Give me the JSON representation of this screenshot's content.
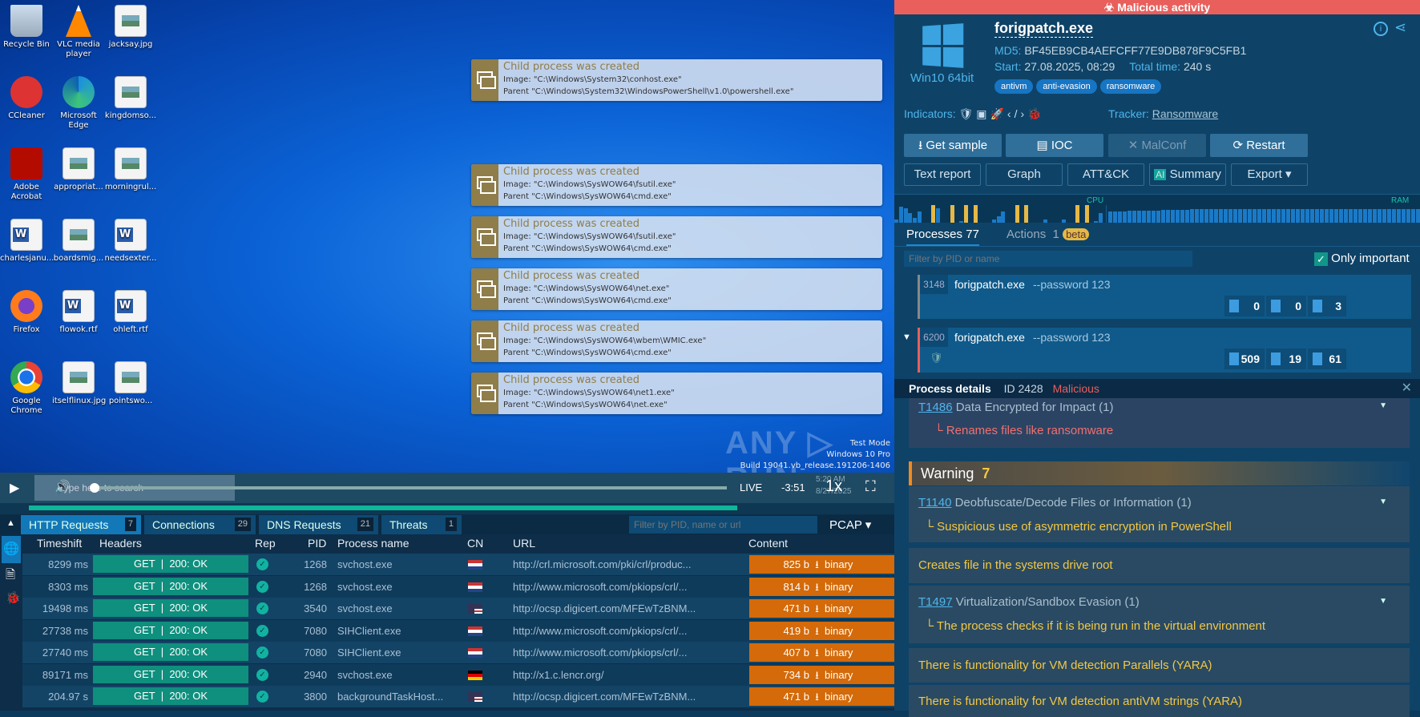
{
  "desktop": {
    "icons": [
      {
        "label": "Recycle Bin",
        "icon": "recycle-bin-icon"
      },
      {
        "label": "VLC media player",
        "icon": "vlc-icon"
      },
      {
        "label": "jacksay.jpg",
        "icon": "image-file-icon"
      },
      {
        "label": "CCleaner",
        "icon": "ccleaner-icon"
      },
      {
        "label": "Microsoft Edge",
        "icon": "edge-icon"
      },
      {
        "label": "kingdomso...",
        "icon": "image-file-icon"
      },
      {
        "label": "Adobe Acrobat",
        "icon": "acrobat-icon"
      },
      {
        "label": "appropriat...",
        "icon": "image-file-icon"
      },
      {
        "label": "morningrul...",
        "icon": "image-file-icon"
      },
      {
        "label": "charlesjanu...",
        "icon": "word-file-icon"
      },
      {
        "label": "boardsmig...",
        "icon": "image-file-icon"
      },
      {
        "label": "needsexter...",
        "icon": "word-file-icon"
      },
      {
        "label": "Firefox",
        "icon": "firefox-icon"
      },
      {
        "label": "flowok.rtf",
        "icon": "word-file-icon"
      },
      {
        "label": "ohleft.rtf",
        "icon": "word-file-icon"
      },
      {
        "label": "Google Chrome",
        "icon": "chrome-icon"
      },
      {
        "label": "itselflinux.jpg",
        "icon": "image-file-icon"
      },
      {
        "label": "pointswo...",
        "icon": "image-file-icon"
      }
    ],
    "notifications": [
      {
        "title": "Child process was created",
        "image": "Image: \"C:\\Windows\\System32\\conhost.exe\"",
        "parent": "Parent \"C:\\Windows\\System32\\WindowsPowerShell\\v1.0\\powershell.exe\""
      },
      {
        "title": "Child process was created",
        "image": "Image: \"C:\\Windows\\SysWOW64\\fsutil.exe\"",
        "parent": "Parent \"C:\\Windows\\SysWOW64\\cmd.exe\""
      },
      {
        "title": "Child process was created",
        "image": "Image: \"C:\\Windows\\SysWOW64\\fsutil.exe\"",
        "parent": "Parent \"C:\\Windows\\SysWOW64\\cmd.exe\""
      },
      {
        "title": "Child process was created",
        "image": "Image: \"C:\\Windows\\SysWOW64\\net.exe\"",
        "parent": "Parent \"C:\\Windows\\SysWOW64\\cmd.exe\""
      },
      {
        "title": "Child process was created",
        "image": "Image: \"C:\\Windows\\SysWOW64\\wbem\\WMIC.exe\"",
        "parent": "Parent \"C:\\Windows\\SysWOW64\\cmd.exe\""
      },
      {
        "title": "Child process was created",
        "image": "Image: \"C:\\Windows\\SysWOW64\\net1.exe\"",
        "parent": "Parent \"C:\\Windows\\SysWOW64\\net.exe\""
      }
    ],
    "watermark": "ANY RUN",
    "os_info": [
      "Test Mode",
      "Windows 10 Pro",
      "Build 19041.vb_release.191206-1406"
    ],
    "search_placeholder": "Type here to search",
    "clock_time": "5:20 AM",
    "clock_date": "8/27/2025"
  },
  "player": {
    "live": "LIVE",
    "time": "-3:51",
    "speed": "1x",
    "progress_pct": 88
  },
  "network": {
    "tabs": [
      {
        "label": "HTTP Requests",
        "count": "7"
      },
      {
        "label": "Connections",
        "count": "29"
      },
      {
        "label": "DNS Requests",
        "count": "21"
      },
      {
        "label": "Threats",
        "count": "1"
      }
    ],
    "filter_placeholder": "Filter by PID, name or url",
    "pcap": "PCAP",
    "columns": [
      "Timeshift",
      "Headers",
      "Rep",
      "PID",
      "Process name",
      "CN",
      "URL",
      "Content"
    ],
    "rows": [
      {
        "time": "8299 ms",
        "method": "GET",
        "status": "200: OK",
        "pid": "1268",
        "process": "svchost.exe",
        "cn": "nl",
        "url": "http://crl.microsoft.com/pki/crl/produc...",
        "size": "825 b",
        "type": "binary"
      },
      {
        "time": "8303 ms",
        "method": "GET",
        "status": "200: OK",
        "pid": "1268",
        "process": "svchost.exe",
        "cn": "nl",
        "url": "http://www.microsoft.com/pkiops/crl/...",
        "size": "814 b",
        "type": "binary"
      },
      {
        "time": "19498 ms",
        "method": "GET",
        "status": "200: OK",
        "pid": "3540",
        "process": "svchost.exe",
        "cn": "us",
        "url": "http://ocsp.digicert.com/MFEwTzBNM...",
        "size": "471 b",
        "type": "binary"
      },
      {
        "time": "27738 ms",
        "method": "GET",
        "status": "200: OK",
        "pid": "7080",
        "process": "SIHClient.exe",
        "cn": "nl",
        "url": "http://www.microsoft.com/pkiops/crl/...",
        "size": "419 b",
        "type": "binary"
      },
      {
        "time": "27740 ms",
        "method": "GET",
        "status": "200: OK",
        "pid": "7080",
        "process": "SIHClient.exe",
        "cn": "nl",
        "url": "http://www.microsoft.com/pkiops/crl/...",
        "size": "407 b",
        "type": "binary"
      },
      {
        "time": "89171 ms",
        "method": "GET",
        "status": "200: OK",
        "pid": "2940",
        "process": "svchost.exe",
        "cn": "de",
        "url": "http://x1.c.lencr.org/",
        "size": "734 b",
        "type": "binary"
      },
      {
        "time": "204.97 s",
        "method": "GET",
        "status": "200: OK",
        "pid": "3800",
        "process": "backgroundTaskHost...",
        "cn": "us",
        "url": "http://ocsp.digicert.com/MFEwTzBNM...",
        "size": "471 b",
        "type": "binary"
      }
    ]
  },
  "report": {
    "verdict": "Malicious activity",
    "os": "Win10 64bit",
    "filename": "forigpatch.exe",
    "md5_label": "MD5:",
    "md5": "BF45EB9CB4AEFCFF77E9DB878F9C5FB1",
    "start_label": "Start:",
    "start": "27.08.2025, 08:29",
    "total_label": "Total time:",
    "total": "240 s",
    "tags": [
      "antivm",
      "anti-evasion",
      "ransomware"
    ],
    "indicators_label": "Indicators:",
    "tracker_label": "Tracker:",
    "tracker": "Ransomware",
    "buttons": [
      "Get sample",
      "IOC",
      "MalConf",
      "Restart"
    ],
    "buttons2": [
      "Text report",
      "Graph",
      "ATT&CK",
      "Summary",
      "Export ▾"
    ],
    "ai": "AI",
    "cpu": "CPU",
    "ram": "RAM",
    "tabs": {
      "processes": "Processes 77",
      "actions": "Actions",
      "actions_count": "1",
      "beta": "beta"
    },
    "filter_placeholder": "Filter by PID or name",
    "only_important": "Only important",
    "processes": [
      {
        "pid": "3148",
        "name": "forigpatch.exe",
        "args": "--password 123",
        "files": "0",
        "modules": "0",
        "threads": "3"
      },
      {
        "pid": "6200",
        "name": "forigpatch.exe",
        "args": "--password 123",
        "files": "509",
        "modules": "19",
        "threads": "61"
      }
    ],
    "details": {
      "title": "Process details",
      "id": "ID 2428",
      "verdict": "Malicious",
      "malicious_item": {
        "tid": "T1486",
        "name": "Data Encrypted for Impact (1)",
        "sub": "Renames files like ransomware"
      },
      "warning_label": "Warning",
      "warning_count": "7",
      "warnings": [
        {
          "tid": "T1140",
          "name": "Deobfuscate/Decode Files or Information (1)",
          "sub": "Suspicious use of asymmetric encryption in PowerShell"
        },
        {
          "text": "Creates file in the systems drive root"
        },
        {
          "tid": "T1497",
          "name": "Virtualization/Sandbox Evasion (1)",
          "sub": "The process checks if it is being run in the virtual environment"
        },
        {
          "text": "There is functionality for VM detection Parallels (YARA)"
        },
        {
          "text": "There is functionality for VM detection antiVM strings (YARA)"
        }
      ]
    }
  },
  "colors": {
    "malicious": "#e85f5c",
    "warning": "#f2c744",
    "accent": "#4fb5ec",
    "http_ok": "#0f8f7e",
    "content": "#d46a09"
  }
}
